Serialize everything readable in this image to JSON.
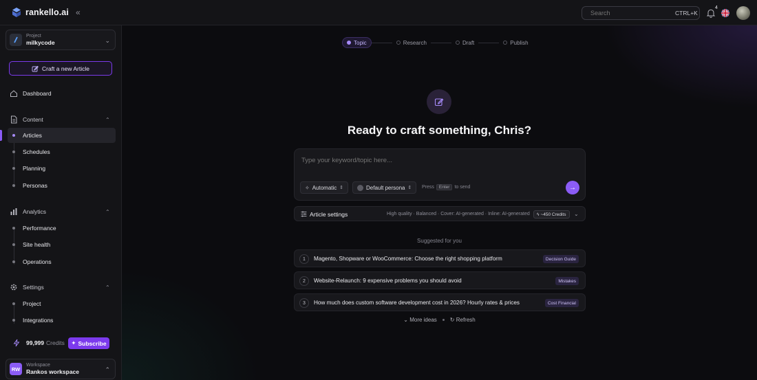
{
  "brand": {
    "name": "rankello.ai"
  },
  "search": {
    "placeholder": "Search",
    "shortcut": "CTRL+K"
  },
  "notifications": {
    "count": "4"
  },
  "sidebar": {
    "project": {
      "label": "Project",
      "name": "milkycode"
    },
    "craft_button": "Craft a new Article",
    "dashboard": "Dashboard",
    "content": {
      "label": "Content",
      "items": [
        "Articles",
        "Schedules",
        "Planning",
        "Personas"
      ],
      "active": "Articles"
    },
    "analytics": {
      "label": "Analytics",
      "items": [
        "Performance",
        "Site health",
        "Operations"
      ]
    },
    "settings": {
      "label": "Settings",
      "items": [
        "Project",
        "Integrations"
      ]
    },
    "credits": {
      "value": "99,999",
      "word": "Credits"
    },
    "subscribe": "Subscribe",
    "workspace": {
      "label": "Workspace",
      "initials": "RW",
      "name": "Rankos workspace"
    }
  },
  "stepper": {
    "steps": [
      "Topic",
      "Research",
      "Draft",
      "Publish"
    ],
    "active": "Topic"
  },
  "hero": {
    "title": "Ready to craft something, Chris?"
  },
  "composer": {
    "placeholder": "Type your keyword/topic here...",
    "mode": "Automatic",
    "persona": "Default persona",
    "hint_press": "Press",
    "hint_key": "Enter",
    "hint_action": "to send"
  },
  "article_settings": {
    "title": "Article settings",
    "summary": "High quality · Balanced · Cover: AI-generated · Inline: AI-generated",
    "credits": "~450 Credits"
  },
  "suggestions": {
    "heading": "Suggested for you",
    "items": [
      {
        "num": "1",
        "text": "Magento, Shopware or WooCommerce: Choose the right shopping platform",
        "tag": "Decision Guide"
      },
      {
        "num": "2",
        "text": "Website-Relaunch: 9 expensive problems you should avoid",
        "tag": "Mistakes"
      },
      {
        "num": "3",
        "text": "How much does custom software development cost in 2026? Hourly rates & prices",
        "tag": "Cost Financial"
      }
    ]
  },
  "actions": {
    "more": "More ideas",
    "refresh": "Refresh"
  },
  "colors": {
    "accent": "#8b5cf6",
    "background": "#0c0c0f",
    "panel": "#18181c"
  }
}
